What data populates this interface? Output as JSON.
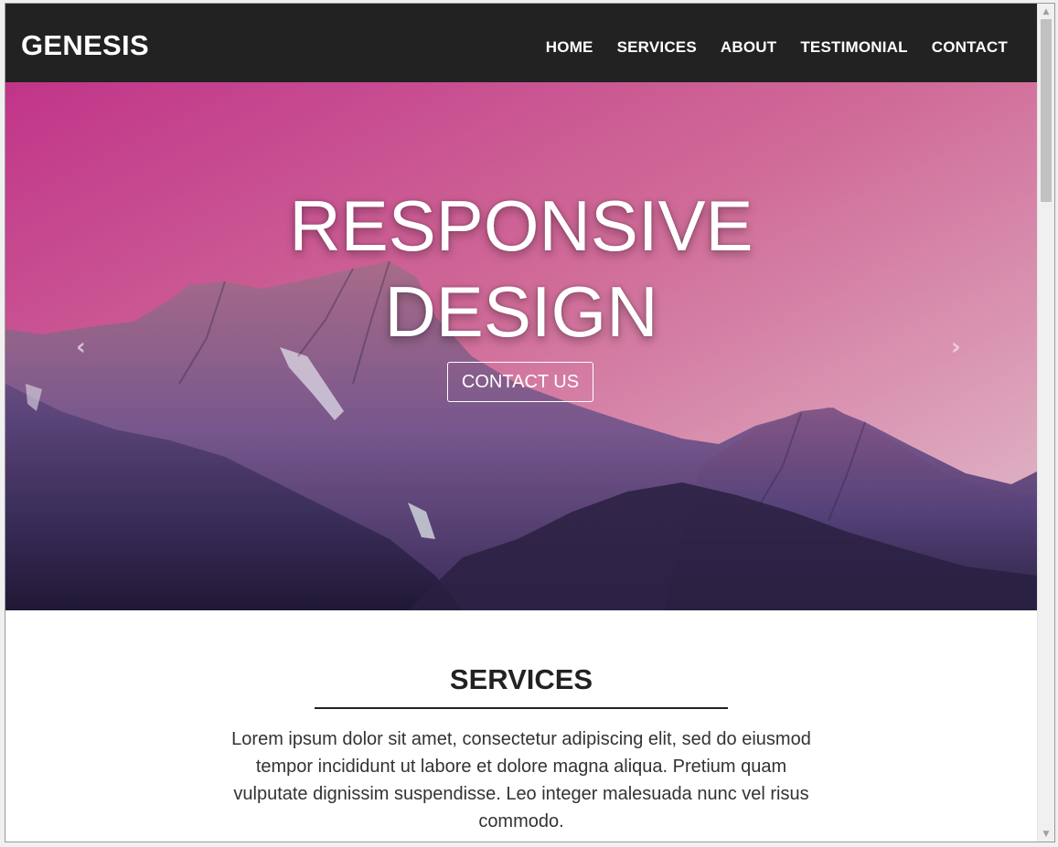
{
  "navbar": {
    "brand": "GENESIS",
    "links": [
      "HOME",
      "SERVICES",
      "ABOUT",
      "TESTIMONIAL",
      "CONTACT"
    ],
    "background_color": "#222222"
  },
  "hero": {
    "title_line1": "RESPONSIVE",
    "title_line2": "DESIGN",
    "button_label": "CONTACT US",
    "prev_icon": "chevron-left-icon",
    "next_icon": "chevron-right-icon",
    "sky_colors": [
      "#c9378f",
      "#e8b3c8"
    ],
    "mountain_color": "#4a3a7a"
  },
  "services": {
    "title": "SERVICES",
    "text": "Lorem ipsum dolor sit amet, consectetur adipiscing elit, sed do eiusmod tempor incididunt ut labore et dolore magna aliqua. Pretium quam vulputate dignissim suspendisse. Leo integer malesuada nunc vel risus commodo."
  },
  "scrollbar": {
    "up_icon": "scroll-up-arrow-icon",
    "down_icon": "scroll-down-arrow-icon"
  }
}
